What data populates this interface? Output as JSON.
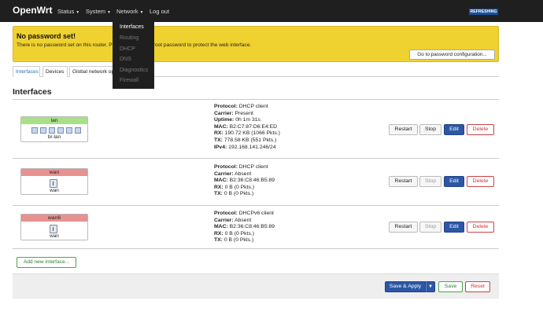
{
  "nav": {
    "brand": "OpenWrt",
    "status": "Status",
    "system": "System",
    "network": "Network",
    "logout": "Log out",
    "refreshing": "REFRESHING"
  },
  "dropdown": {
    "items": [
      "Interfaces",
      "Routing",
      "DHCP",
      "DNS",
      "Diagnostics",
      "Firewall"
    ],
    "active": "Interfaces"
  },
  "alert": {
    "title": "No password set!",
    "text": "There is no password set on this router. Please configure a root password to protect the web interface.",
    "button": "Go to password configuration..."
  },
  "tabs": [
    "Interfaces",
    "Devices",
    "Global network options"
  ],
  "section_title": "Interfaces",
  "interfaces": [
    {
      "name": "lan",
      "device": "br-lan",
      "color": "#a8e08a",
      "info": [
        {
          "k": "Protocol:",
          "v": " DHCP client"
        },
        {
          "k": "Carrier:",
          "v": " Present"
        },
        {
          "k": "Uptime:",
          "v": " 0h 1m 31s"
        },
        {
          "k": "MAC:",
          "v": " B2:C7:87:D6:E4:ED"
        },
        {
          "k": "RX:",
          "v": " 190.72 KB (1066 Pkts.)"
        },
        {
          "k": "TX:",
          "v": " 778.58 KB (551 Pkts.)"
        },
        {
          "k": "IPv4:",
          "v": " 192.168.141.246/24"
        }
      ],
      "stop_disabled": false
    },
    {
      "name": "wan",
      "device": "wan",
      "color": "#e79191",
      "info": [
        {
          "k": "Protocol:",
          "v": " DHCP client"
        },
        {
          "k": "Carrier:",
          "v": " Absent"
        },
        {
          "k": "MAC:",
          "v": " B2:36:C8:46:B5:89"
        },
        {
          "k": "RX:",
          "v": " 0 B (0 Pkts.)"
        },
        {
          "k": "TX:",
          "v": " 0 B (0 Pkts.)"
        }
      ],
      "stop_disabled": true
    },
    {
      "name": "wan6",
      "device": "wan",
      "color": "#e79191",
      "info": [
        {
          "k": "Protocol:",
          "v": " DHCPv6 client"
        },
        {
          "k": "Carrier:",
          "v": " Absent"
        },
        {
          "k": "MAC:",
          "v": " B2:36:C8:46:B5:89"
        },
        {
          "k": "RX:",
          "v": " 0 B (0 Pkts.)"
        },
        {
          "k": "TX:",
          "v": " 0 B (0 Pkts.)"
        }
      ],
      "stop_disabled": true
    }
  ],
  "row_buttons": {
    "restart": "Restart",
    "stop": "Stop",
    "edit": "Edit",
    "delete": "Delete"
  },
  "add_interface": "Add new interface...",
  "footer": {
    "save_apply": "Save & Apply",
    "save": "Save",
    "reset": "Reset"
  }
}
